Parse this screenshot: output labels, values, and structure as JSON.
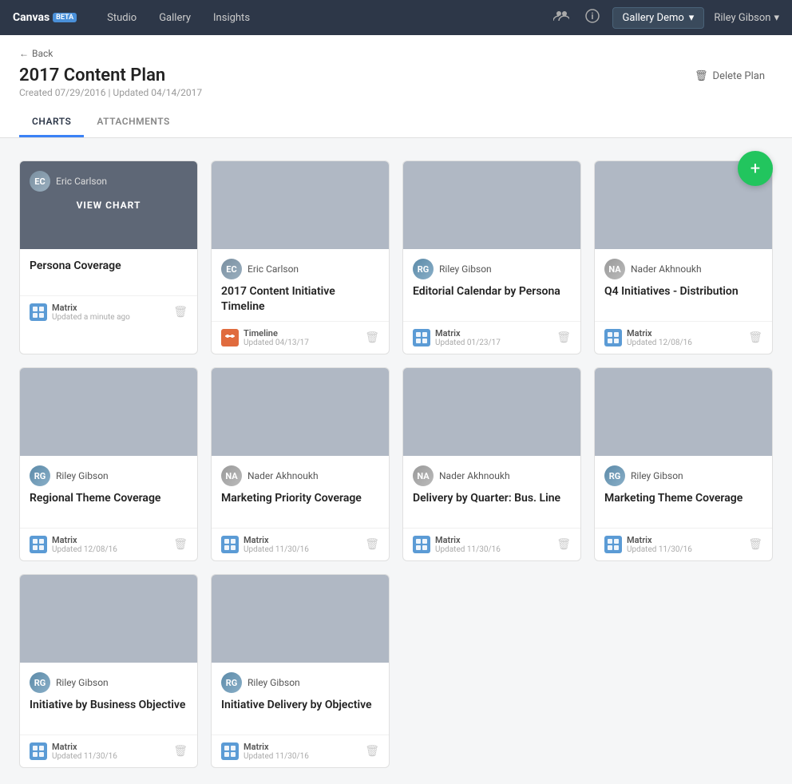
{
  "nav": {
    "brand": "Canvas",
    "beta": "BETA",
    "links": [
      "Studio",
      "Gallery",
      "Insights"
    ],
    "gallery_demo": "Gallery Demo",
    "user": "Riley Gibson",
    "icons": [
      "users-icon",
      "info-icon"
    ]
  },
  "page": {
    "back_label": "Back",
    "title": "2017 Content Plan",
    "created": "Created 07/29/2016  |  Updated 04/14/2017",
    "delete_label": "Delete Plan",
    "tabs": [
      "CHARTS",
      "ATTACHMENTS"
    ],
    "active_tab": "CHARTS"
  },
  "fab_label": "+",
  "cards": [
    {
      "id": 1,
      "author": "Eric Carlson",
      "author_type": "eric",
      "title": "Persona Coverage",
      "chart_type": "Matrix",
      "chart_icon": "matrix",
      "updated": "Updated a minute ago",
      "hovered": true
    },
    {
      "id": 2,
      "author": "Eric Carlson",
      "author_type": "eric",
      "title": "2017 Content Initiative Timeline",
      "chart_type": "Timeline",
      "chart_icon": "timeline",
      "updated": "Updated 04/13/17",
      "hovered": false
    },
    {
      "id": 3,
      "author": "Riley Gibson",
      "author_type": "riley",
      "title": "Editorial Calendar by Persona",
      "chart_type": "Matrix",
      "chart_icon": "matrix",
      "updated": "Updated 01/23/17",
      "hovered": false
    },
    {
      "id": 4,
      "author": "Nader Akhnoukh",
      "author_type": "nader",
      "title": "Q4 Initiatives - Distribution",
      "chart_type": "Matrix",
      "chart_icon": "matrix",
      "updated": "Updated 12/08/16",
      "hovered": false
    },
    {
      "id": 5,
      "author": "Riley Gibson",
      "author_type": "riley",
      "title": "Regional Theme Coverage",
      "chart_type": "Matrix",
      "chart_icon": "matrix",
      "updated": "Updated 12/08/16",
      "hovered": false
    },
    {
      "id": 6,
      "author": "Nader Akhnoukh",
      "author_type": "nader",
      "title": "Marketing Priority Coverage",
      "chart_type": "Matrix",
      "chart_icon": "matrix",
      "updated": "Updated 11/30/16",
      "hovered": false
    },
    {
      "id": 7,
      "author": "Nader Akhnoukh",
      "author_type": "nader",
      "title": "Delivery by Quarter: Bus. Line",
      "chart_type": "Matrix",
      "chart_icon": "matrix",
      "updated": "Updated 11/30/16",
      "hovered": false
    },
    {
      "id": 8,
      "author": "Riley Gibson",
      "author_type": "riley",
      "title": "Marketing Theme Coverage",
      "chart_type": "Matrix",
      "chart_icon": "matrix",
      "updated": "Updated 11/30/16",
      "hovered": false
    },
    {
      "id": 9,
      "author": "Riley Gibson",
      "author_type": "riley",
      "title": "Initiative by Business Objective",
      "chart_type": "Matrix",
      "chart_icon": "matrix",
      "updated": "Updated 11/30/16",
      "hovered": false
    },
    {
      "id": 10,
      "author": "Riley Gibson",
      "author_type": "riley",
      "title": "Initiative Delivery by Objective",
      "chart_type": "Matrix",
      "chart_icon": "matrix",
      "updated": "Updated 11/30/16",
      "hovered": false
    }
  ],
  "view_chart_label": "VIEW CHART",
  "colors": {
    "accent_green": "#22c55e",
    "matrix_blue": "#5b9bd5",
    "timeline_orange": "#e06b3e",
    "nav_bg": "#2d3748"
  }
}
